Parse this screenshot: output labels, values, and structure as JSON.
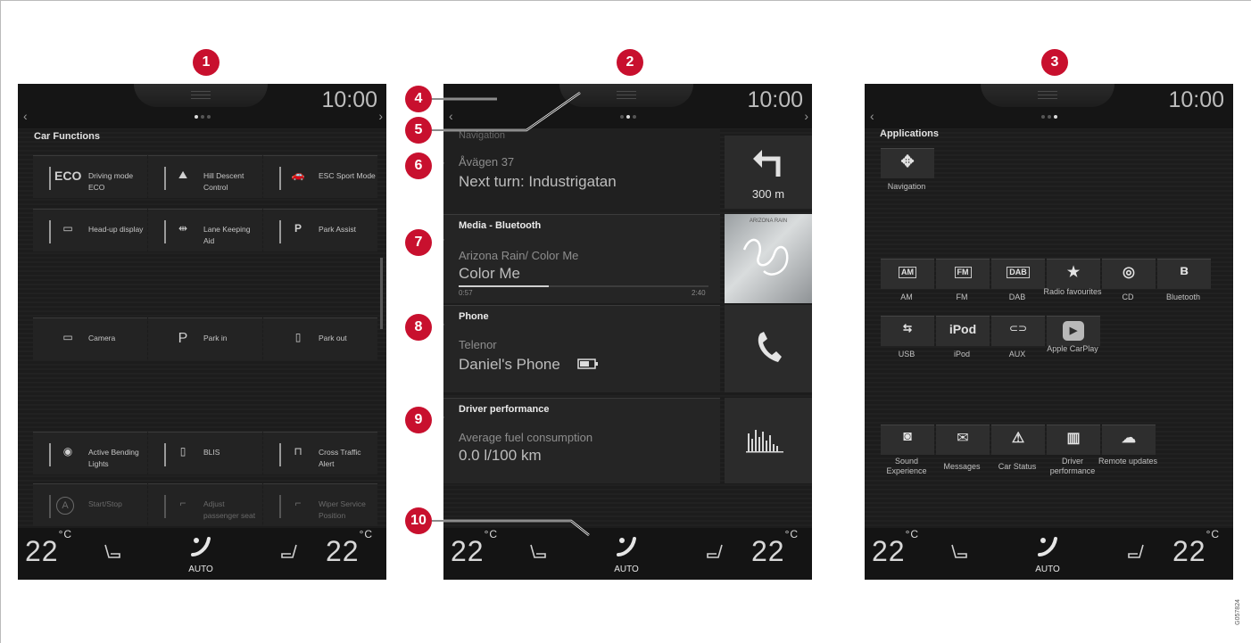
{
  "callouts": [
    "1",
    "2",
    "3",
    "4",
    "5",
    "6",
    "7",
    "8",
    "9",
    "10"
  ],
  "clock": "10:00",
  "nav": {
    "prev": "‹",
    "next": "›"
  },
  "climate": {
    "left_temp": "22",
    "right_temp": "22",
    "unit": "°C",
    "fan_mode": "AUTO"
  },
  "car_functions": {
    "title": "Car Functions",
    "tiles": [
      {
        "icon": "ECO",
        "label": "Driving mode ECO"
      },
      {
        "icon": "⛰",
        "label": "Hill Descent Control"
      },
      {
        "icon": "🚗",
        "label": "ESC Sport Mode"
      },
      {
        "icon": "▭",
        "label": "Head-up display"
      },
      {
        "icon": "⇹",
        "label": "Lane Keeping Aid"
      },
      {
        "icon": "P",
        "label": "Park Assist"
      },
      {
        "icon": "▭",
        "label": "Camera"
      },
      {
        "icon": "P",
        "label": "Park in"
      },
      {
        "icon": "▯",
        "label": "Park out"
      },
      {
        "icon": "◉",
        "label": "Active Bending Lights"
      },
      {
        "icon": "▯",
        "label": "BLIS"
      },
      {
        "icon": "⊓",
        "label": "Cross Traffic Alert"
      },
      {
        "icon": "A",
        "label": "Start/Stop"
      },
      {
        "icon": "⌐",
        "label": "Adjust passenger seat"
      },
      {
        "icon": "⌐",
        "label": "Wiper Service Position"
      }
    ]
  },
  "home": {
    "navigation": {
      "header": "Navigation",
      "street": "Åvägen 37",
      "next_turn": "Next turn: Industrigatan",
      "distance": "300 m"
    },
    "media": {
      "header": "Media - Bluetooth",
      "track": "Arizona Rain/ Color Me",
      "title": "Color Me",
      "elapsed": "0:57",
      "total": "2:40",
      "album_caption": "ARIZONA RAIN",
      "progress": 0.36
    },
    "phone": {
      "header": "Phone",
      "carrier": "Telenor",
      "device": "Daniel's Phone"
    },
    "driver_performance": {
      "header": "Driver performance",
      "metric": "Average fuel consumption",
      "value": "0.0 l/100 km"
    }
  },
  "applications": {
    "title": "Applications",
    "nav_app": {
      "glyph": "✥",
      "label": "Navigation"
    },
    "media_apps": [
      {
        "glyph": "AM",
        "label": "AM"
      },
      {
        "glyph": "FM",
        "label": "FM"
      },
      {
        "glyph": "DAB",
        "label": "DAB"
      },
      {
        "glyph": "★",
        "label": "Radio favourites"
      },
      {
        "glyph": "◎",
        "label": "CD"
      },
      {
        "glyph": "ʙ",
        "label": "Bluetooth"
      },
      {
        "glyph": "⇆",
        "label": "USB"
      },
      {
        "glyph": "iPod",
        "label": "iPod"
      },
      {
        "glyph": "⊂⊃",
        "label": "AUX"
      },
      {
        "glyph": "▶",
        "label": "Apple CarPlay"
      }
    ],
    "system_apps": [
      {
        "glyph": "◙",
        "label": "Sound Experience"
      },
      {
        "glyph": "✉",
        "label": "Messages"
      },
      {
        "glyph": "⚠",
        "label": "Car Status"
      },
      {
        "glyph": "▥",
        "label": "Driver performance"
      },
      {
        "glyph": "☁",
        "label": "Remote updates"
      }
    ]
  },
  "doc_id": "G057824",
  "colors": {
    "callout": "#c8102e",
    "screen_bg": "#1c1c1c"
  }
}
